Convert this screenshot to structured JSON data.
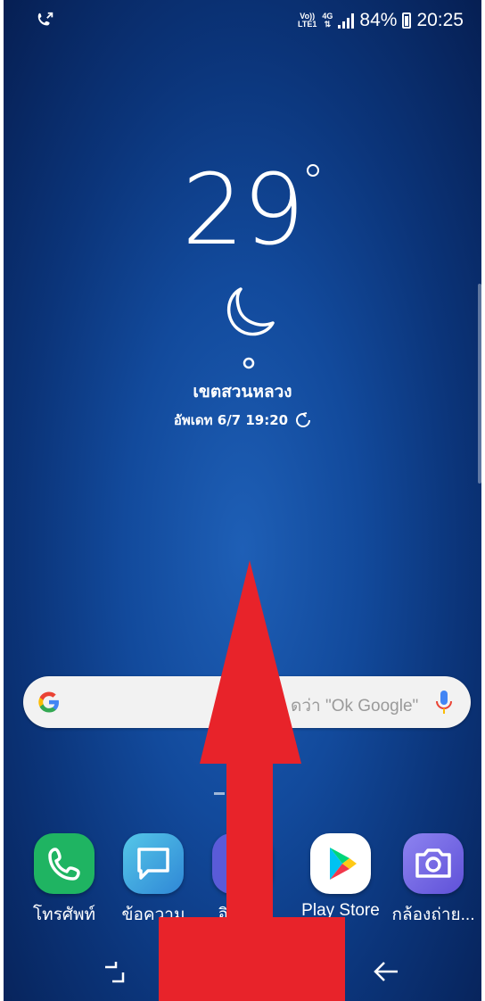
{
  "status_bar": {
    "left_icon": "call-forward-icon",
    "volte_top": "Vo))",
    "volte_bottom": "LTE1",
    "network": "4G",
    "battery_percent": "84%",
    "time": "20:25"
  },
  "weather": {
    "temperature": "29",
    "condition_icon": "crescent-moon-icon",
    "location": "เขตสวนหลวง",
    "updated": "อัพเดท 6/7 19:20"
  },
  "search": {
    "hint": "ดว่า \"Ok Google\""
  },
  "dock": {
    "apps": [
      {
        "label": "โทรศัพท์",
        "icon": "phone-icon",
        "color": "#1fb462"
      },
      {
        "label": "ข้อความ",
        "icon": "message-icon",
        "color": "#3aa0d8"
      },
      {
        "label": "อิน         นิ๊ต",
        "icon": "internet-icon",
        "color": "#5a5bd8"
      },
      {
        "label": "Play Store",
        "icon": "play-store-icon",
        "color": "#ffffff"
      },
      {
        "label": "กล้องถ่าย...",
        "icon": "camera-icon",
        "color": "#7b6fe6"
      }
    ]
  },
  "overlay": {
    "arrow_color": "#e8232a",
    "arrow_direction": "up"
  }
}
